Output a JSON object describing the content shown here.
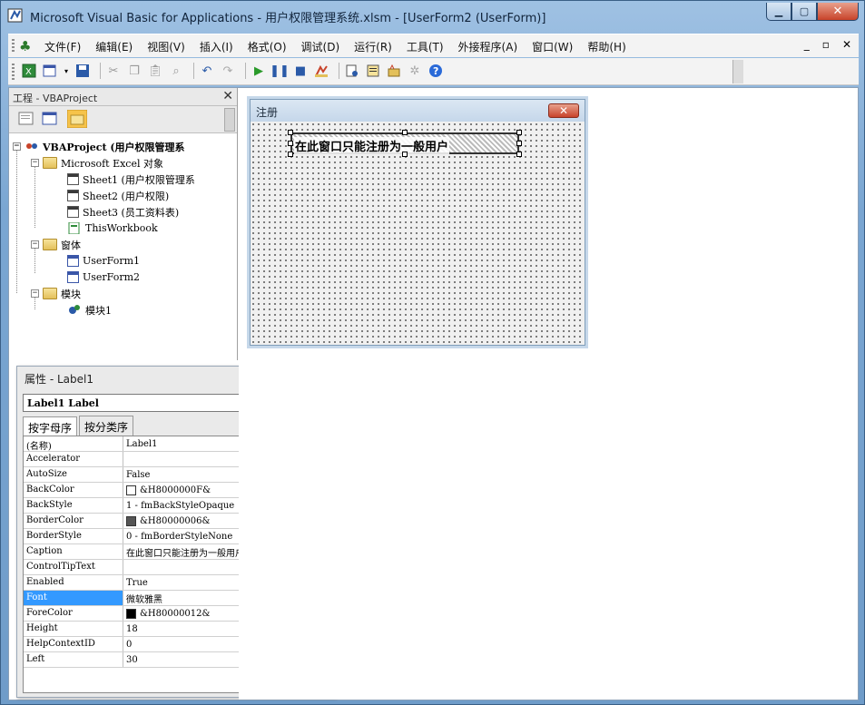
{
  "window": {
    "title": "Microsoft Visual Basic for Applications - 用户权限管理系统.xlsm - [UserForm2 (UserForm)]"
  },
  "menubar": {
    "items": [
      "文件(F)",
      "编辑(E)",
      "视图(V)",
      "插入(I)",
      "格式(O)",
      "调试(D)",
      "运行(R)",
      "工具(T)",
      "外接程序(A)",
      "窗口(W)",
      "帮助(H)"
    ]
  },
  "project": {
    "title": "工程 - VBAProject",
    "tree": {
      "root": "VBAProject (用户权限管理系",
      "excel_objects": "Microsoft Excel 对象",
      "sheets": [
        "Sheet1 (用户权限管理系",
        "Sheet2 (用户权限)",
        "Sheet3 (员工资料表)",
        "ThisWorkbook"
      ],
      "forms_folder": "窗体",
      "forms": [
        "UserForm1",
        "UserForm2"
      ],
      "modules_folder": "模块",
      "modules": [
        "模块1"
      ]
    }
  },
  "properties": {
    "title": "属性 - Label1",
    "object_combo": "Label1 Label",
    "tabs": [
      "按字母序",
      "按分类序"
    ],
    "rows": [
      {
        "name": "(名称)",
        "value": "Label1"
      },
      {
        "name": "Accelerator",
        "value": ""
      },
      {
        "name": "AutoSize",
        "value": "False"
      },
      {
        "name": "BackColor",
        "value": "&H8000000F&",
        "swatch": "#ffffff"
      },
      {
        "name": "BackStyle",
        "value": "1 - fmBackStyleOpaque"
      },
      {
        "name": "BorderColor",
        "value": "&H80000006&",
        "swatch": "#555555"
      },
      {
        "name": "BorderStyle",
        "value": "0 - fmBorderStyleNone"
      },
      {
        "name": "Caption",
        "value": "在此窗口只能注册为一般用户"
      },
      {
        "name": "ControlTipText",
        "value": ""
      },
      {
        "name": "Enabled",
        "value": "True"
      },
      {
        "name": "Font",
        "value": "微软雅黑",
        "selected": true
      },
      {
        "name": "ForeColor",
        "value": "&H80000012&",
        "swatch": "#000000"
      },
      {
        "name": "Height",
        "value": "18"
      },
      {
        "name": "HelpContextID",
        "value": "0"
      },
      {
        "name": "Left",
        "value": "30"
      }
    ]
  },
  "userform": {
    "title": "注册",
    "label_caption": "在此窗口只能注册为一般用户"
  }
}
